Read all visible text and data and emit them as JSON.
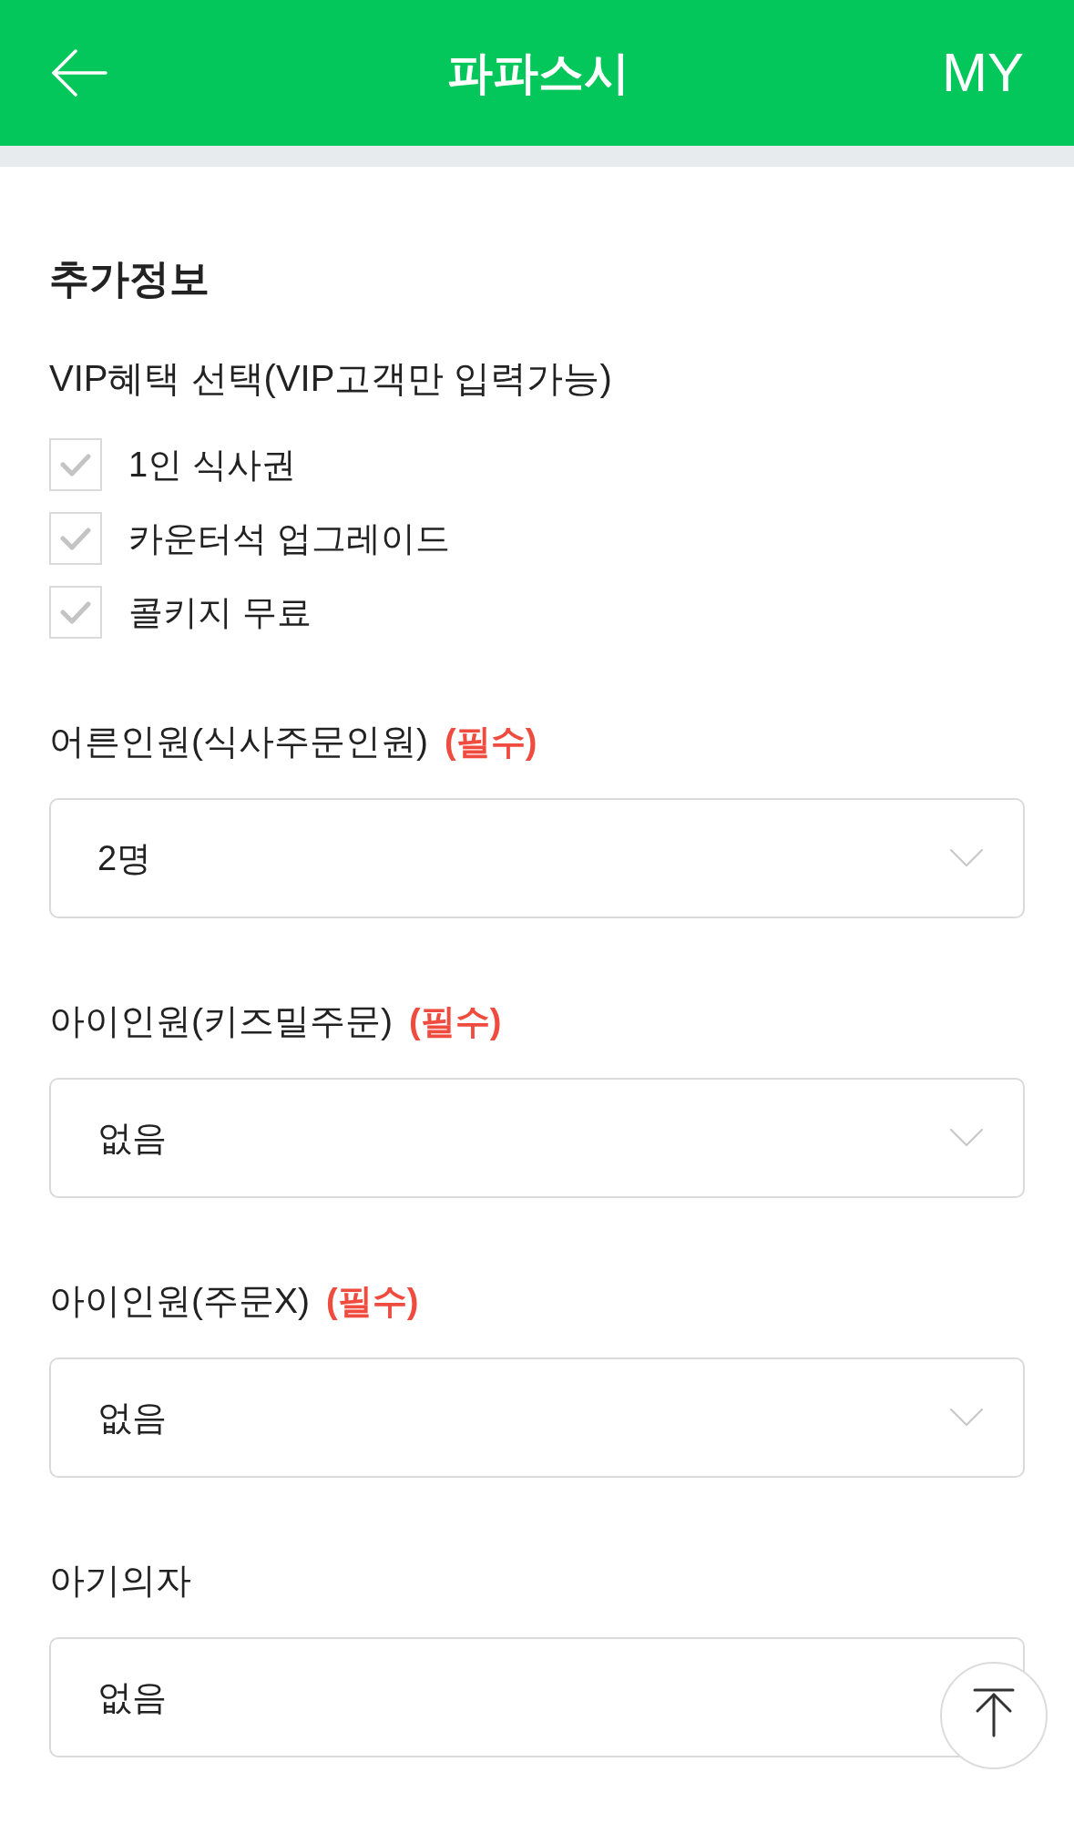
{
  "header": {
    "title": "파파스시",
    "my_link": "MY"
  },
  "section": {
    "title": "추가정보",
    "vip": {
      "label": "VIP혜택 선택(VIP고객만 입력가능)",
      "options": [
        {
          "label": "1인 식사권",
          "checked": false
        },
        {
          "label": "카운터석 업그레이드",
          "checked": false
        },
        {
          "label": "콜키지 무료",
          "checked": false
        }
      ]
    }
  },
  "fields": [
    {
      "label": "어른인원(식사주문인원)",
      "required_mark": "(필수)",
      "value": "2명"
    },
    {
      "label": "아이인원(키즈밀주문)",
      "required_mark": "(필수)",
      "value": "없음"
    },
    {
      "label": "아이인원(주문X)",
      "required_mark": "(필수)",
      "value": "없음"
    },
    {
      "label": "아기의자",
      "value": "없음"
    }
  ]
}
